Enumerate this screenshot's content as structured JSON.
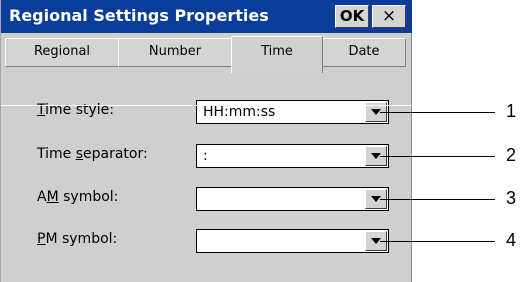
{
  "window": {
    "title": "Regional Settings Properties",
    "ok_label": "OK",
    "close_glyph": "×"
  },
  "tabs": [
    {
      "label": "Regional",
      "active": false
    },
    {
      "label": "Number",
      "active": false
    },
    {
      "label": "Time",
      "active": true
    },
    {
      "label": "Date",
      "active": false
    }
  ],
  "fields": [
    {
      "label_pre": "",
      "label_mnemonic": "T",
      "label_post": "ime style:",
      "value": "HH:mm:ss",
      "icon": "chevron-down-icon"
    },
    {
      "label_pre": "Time ",
      "label_mnemonic": "s",
      "label_post": "eparator:",
      "value": ":",
      "icon": "chevron-down-icon"
    },
    {
      "label_pre": "A",
      "label_mnemonic": "M",
      "label_post": " symbol:",
      "value": "",
      "icon": "chevron-down-icon"
    },
    {
      "label_pre": "",
      "label_mnemonic": "P",
      "label_post": "M symbol:",
      "value": "",
      "icon": "chevron-down-icon"
    }
  ],
  "callouts": [
    "1",
    "2",
    "3",
    "4"
  ],
  "colors": {
    "titlebar": "#0a3c9a",
    "dialog_background": "#cfcfcf"
  }
}
